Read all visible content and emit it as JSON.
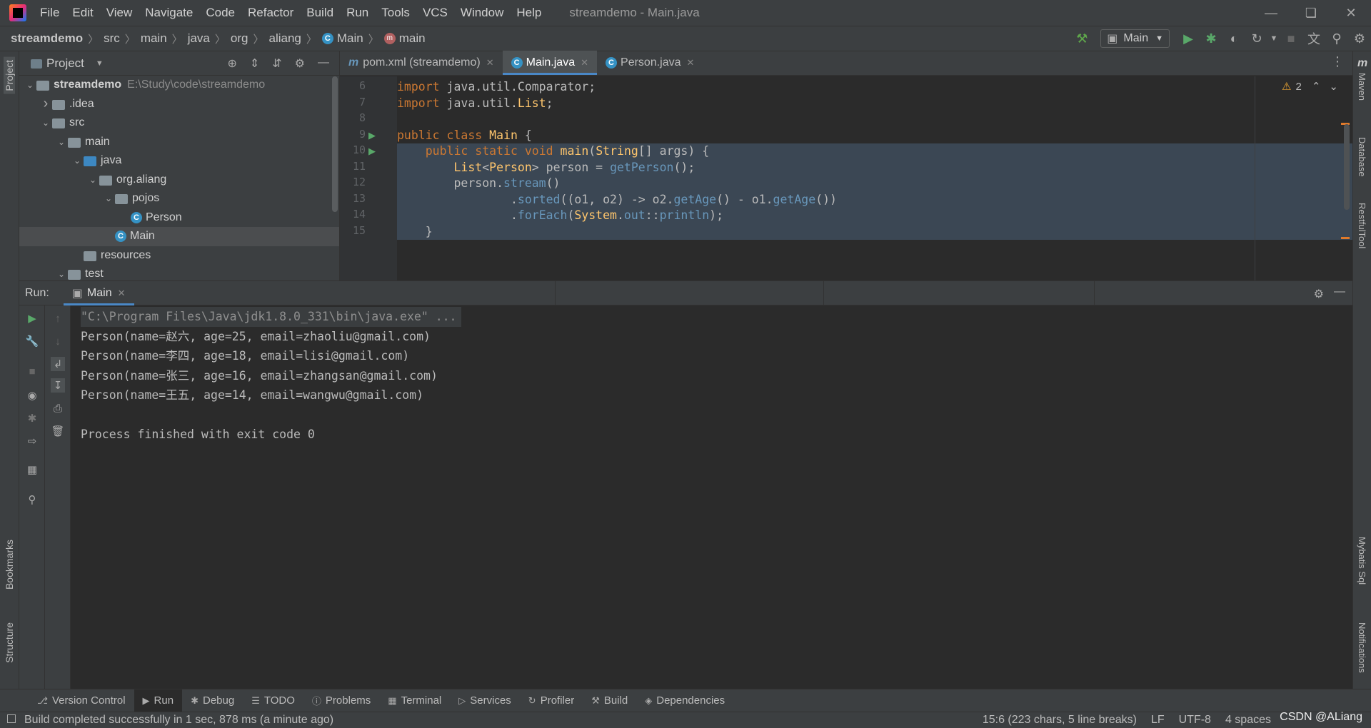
{
  "menu": [
    "File",
    "Edit",
    "View",
    "Navigate",
    "Code",
    "Refactor",
    "Build",
    "Run",
    "Tools",
    "VCS",
    "Window",
    "Help"
  ],
  "window_title": "streamdemo - Main.java",
  "breadcrumbs": [
    "streamdemo",
    "src",
    "main",
    "java",
    "org",
    "aliang",
    "Main",
    "main"
  ],
  "run_config": "Main",
  "left_strip": {
    "project": "Project",
    "bookmarks": "Bookmarks",
    "structure": "Structure"
  },
  "right_strip": {
    "maven": "Maven",
    "database": "Database",
    "restful": "RestfulTool",
    "mybatis": "Mybatis Sql",
    "notifications": "Notifications"
  },
  "project_panel": {
    "title": "Project",
    "tree": [
      {
        "label": "streamdemo",
        "path": "E:\\Study\\code\\streamdemo",
        "indent": 0,
        "arrow": "open",
        "icon": "folder",
        "bold": true
      },
      {
        "label": ".idea",
        "indent": 1,
        "arrow": "closed",
        "icon": "folder"
      },
      {
        "label": "src",
        "indent": 1,
        "arrow": "open",
        "icon": "folder"
      },
      {
        "label": "main",
        "indent": 2,
        "arrow": "open",
        "icon": "folder"
      },
      {
        "label": "java",
        "indent": 3,
        "arrow": "open",
        "icon": "folder-blue"
      },
      {
        "label": "org.aliang",
        "indent": 4,
        "arrow": "open",
        "icon": "package"
      },
      {
        "label": "pojos",
        "indent": 5,
        "arrow": "open",
        "icon": "package"
      },
      {
        "label": "Person",
        "indent": 6,
        "arrow": "none",
        "icon": "class"
      },
      {
        "label": "Main",
        "indent": 5,
        "arrow": "none",
        "icon": "class",
        "selected": true
      },
      {
        "label": "resources",
        "indent": 3,
        "arrow": "none",
        "icon": "folder"
      },
      {
        "label": "test",
        "indent": 2,
        "arrow": "open",
        "icon": "folder"
      }
    ]
  },
  "editor": {
    "tabs": [
      {
        "label": "pom.xml (streamdemo)",
        "icon": "m"
      },
      {
        "label": "Main.java",
        "icon": "class",
        "active": true
      },
      {
        "label": "Person.java",
        "icon": "class"
      }
    ],
    "warnings": "2",
    "lines": [
      {
        "num": "6",
        "text": "import java.util.Comparator;"
      },
      {
        "num": "7",
        "text": "import java.util.List;"
      },
      {
        "num": "8",
        "text": ""
      },
      {
        "num": "9",
        "text": "public class Main {"
      },
      {
        "num": "10",
        "text": "    public static void main(String[] args) {"
      },
      {
        "num": "11",
        "text": "        List<Person> person = getPerson();"
      },
      {
        "num": "12",
        "text": "        person.stream()"
      },
      {
        "num": "13",
        "text": "                .sorted((o1, o2) -> o2.getAge() - o1.getAge())"
      },
      {
        "num": "14",
        "text": "                .forEach(System.out::println);"
      },
      {
        "num": "15",
        "text": "    }"
      }
    ]
  },
  "run_panel": {
    "label": "Run:",
    "tab": "Main",
    "console": [
      "\"C:\\Program Files\\Java\\jdk1.8.0_331\\bin\\java.exe\" ...",
      "Person(name=赵六, age=25, email=zhaoliu@gmail.com)",
      "Person(name=李四, age=18, email=lisi@gmail.com)",
      "Person(name=张三, age=16, email=zhangsan@gmail.com)",
      "Person(name=王五, age=14, email=wangwu@gmail.com)",
      "",
      "Process finished with exit code 0"
    ]
  },
  "bottom_tools": [
    "Version Control",
    "Run",
    "Debug",
    "TODO",
    "Problems",
    "Terminal",
    "Services",
    "Profiler",
    "Build",
    "Dependencies"
  ],
  "status": {
    "message": "Build completed successfully in 1 sec, 878 ms (a minute ago)",
    "position": "15:6 (223 chars, 5 line breaks)",
    "line_sep": "LF",
    "encoding": "UTF-8",
    "indent": "4 spaces",
    "watermark": "CSDN @ALiang"
  }
}
